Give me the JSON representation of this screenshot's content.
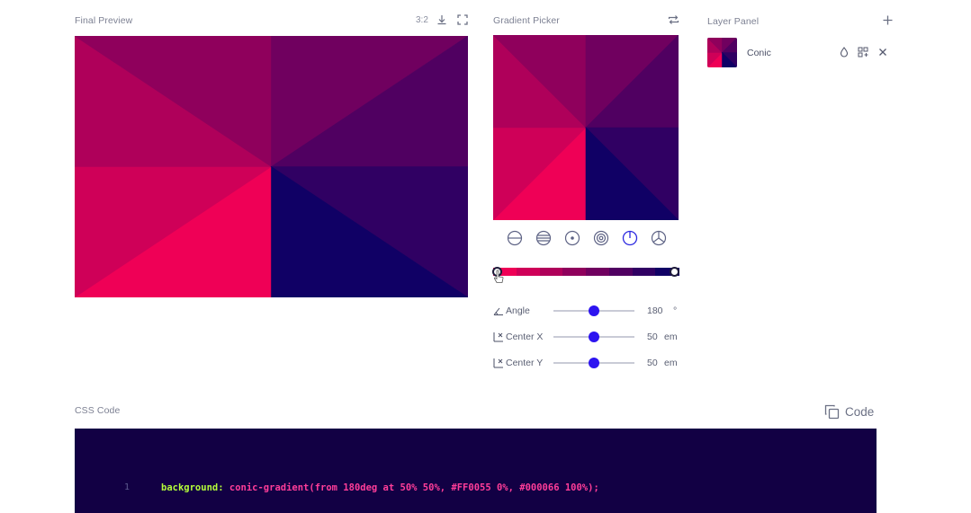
{
  "preview": {
    "title": "Final Preview",
    "ratio": "3:2"
  },
  "picker": {
    "title": "Gradient Picker",
    "types": [
      {
        "name": "linear-type-button",
        "icon": "linear-icon",
        "active": false
      },
      {
        "name": "repeating-linear-type-button",
        "icon": "repeating-linear-icon",
        "active": false
      },
      {
        "name": "radial-type-button",
        "icon": "radial-icon",
        "active": false
      },
      {
        "name": "repeating-radial-type-button",
        "icon": "repeating-radial-icon",
        "active": false
      },
      {
        "name": "conic-type-button",
        "icon": "conic-icon",
        "active": true
      },
      {
        "name": "repeating-conic-type-button",
        "icon": "repeating-conic-icon",
        "active": false
      }
    ],
    "stops": [
      "#FF0055",
      "#000066"
    ],
    "sliders": [
      {
        "name": "angle",
        "label": "Angle",
        "value": "180",
        "unit": "°",
        "fraction": 0.5
      },
      {
        "name": "center-x",
        "label": "Center X",
        "value": "50",
        "unit": "em",
        "fraction": 0.5
      },
      {
        "name": "center-y",
        "label": "Center Y",
        "value": "50",
        "unit": "em",
        "fraction": 0.5
      }
    ]
  },
  "layers": {
    "title": "Layer Panel",
    "items": [
      {
        "name": "Conic"
      }
    ]
  },
  "code": {
    "title": "CSS Code",
    "copy_label": "Code",
    "line_number": "1",
    "property": "background:",
    "value": "conic-gradient(from 180deg at 50% 50%, #FF0055 0%, #000066 100%);"
  },
  "colors": {
    "start": "#FF0055",
    "end": "#000066",
    "accent": "#2d14f0",
    "code_bg": "#120044"
  }
}
